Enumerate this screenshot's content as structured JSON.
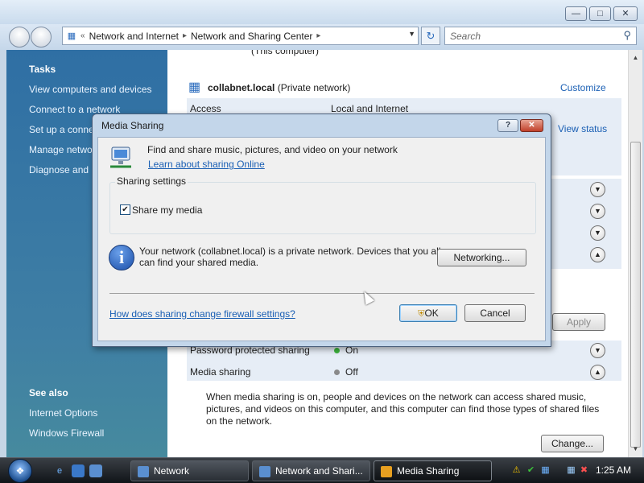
{
  "window": {
    "breadcrumb": [
      "Network and Internet",
      "Network and Sharing Center"
    ],
    "breadcrumb_prefix": "«",
    "search_placeholder": "Search"
  },
  "sidebar": {
    "tasks_heading": "Tasks",
    "tasks": [
      "View computers and devices",
      "Connect to a network",
      "Set up a connection or network",
      "Manage network connections",
      "Diagnose and repair"
    ],
    "see_also_heading": "See also",
    "see_also": [
      "Internet Options",
      "Windows Firewall"
    ]
  },
  "content": {
    "computer_label": "(This computer)",
    "network_name": "collabnet.local",
    "network_type": "(Private network)",
    "customize": "Customize",
    "access_label": "Access",
    "access_value": "Local and Internet",
    "view_status": "View status",
    "apply": "Apply",
    "password_sharing_label": "Password protected sharing",
    "password_sharing_value": "On",
    "media_sharing_label": "Media sharing",
    "media_sharing_value": "Off",
    "media_description": "When media sharing is on, people and devices on the network can access shared music, pictures, and videos on this computer, and this computer can find those types of shared files on the network.",
    "change": "Change...",
    "colors": {
      "on_dot": "#3cb43c",
      "off_dot": "#8a8a8a"
    }
  },
  "dialog": {
    "title": "Media Sharing",
    "help": "?",
    "intro": "Find and share music, pictures, and video on your network",
    "learn_link": "Learn about sharing Online",
    "group_label": "Sharing settings",
    "share_checkbox_label": "Share my media",
    "share_checked": true,
    "checkmark": "✔",
    "info_text_line1": "Your network (collabnet.local) is a private network. Devices that you allow",
    "info_text_line2": "can find your shared media.",
    "networking_button": "Networking...",
    "firewall_link": "How does sharing change firewall settings?",
    "ok_button": "OK",
    "cancel_button": "Cancel"
  },
  "taskbar": {
    "tasks": [
      {
        "label": "Network",
        "icon": "network-folder-icon"
      },
      {
        "label": "Network and Shari...",
        "icon": "network-folder-icon"
      },
      {
        "label": "Media Sharing",
        "icon": "media-player-icon"
      }
    ],
    "clock": "1:25 AM"
  }
}
